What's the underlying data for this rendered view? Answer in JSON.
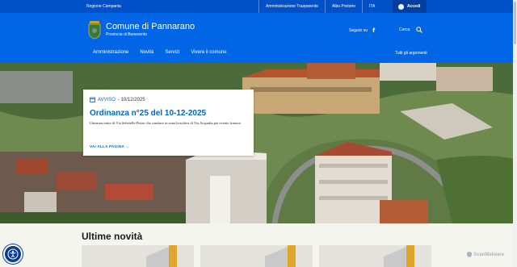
{
  "topbar": {
    "region": "Regione Campania",
    "links": [
      "Amministrazione Trasparente",
      "Albo Pretorio",
      "ITA"
    ],
    "login_label": "Accedi"
  },
  "header": {
    "title": "Comune di Pannarano",
    "subtitle": "Provincia di Benevento",
    "social_label": "Seguici su",
    "social_icon": "facebook-icon",
    "search_label": "Cerca",
    "search_icon": "search-icon"
  },
  "nav": {
    "items": [
      "Amministrazione",
      "Novità",
      "Servizi",
      "Vivere il comune"
    ],
    "all_topics": "Tutti gli argomenti"
  },
  "hero_card": {
    "category": "AVVISO",
    "date": "- 10/12/2025",
    "title": "Ordinanza n°25 del 10-12-2025",
    "description": "Chiusura tratto di Via Sebetelle-Pezze che conduce in zona boschiva di Via Acquafia per evento franoso",
    "link_label": "VAI ALLA PAGINA",
    "calendar_icon": "calendar-icon"
  },
  "latest": {
    "heading": "Ultime novità"
  },
  "accessibility": {
    "icon": "accessibility-icon"
  },
  "watermark": {
    "label": "ScanMalware"
  },
  "colors": {
    "brand": "#0066e6",
    "topbar": "#0050c8",
    "accent": "#0066cc"
  }
}
